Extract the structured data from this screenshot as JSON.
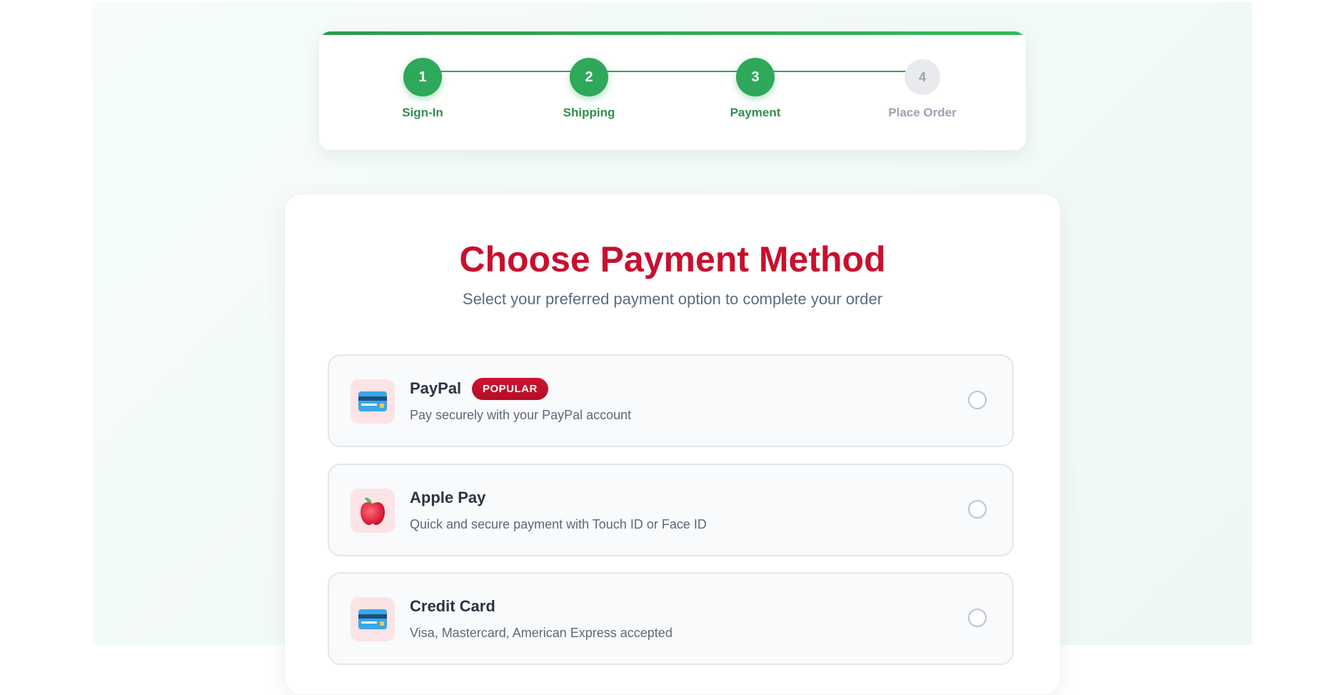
{
  "stepper": {
    "steps": [
      {
        "number": "1",
        "label": "Sign-In",
        "status": "done"
      },
      {
        "number": "2",
        "label": "Shipping",
        "status": "done"
      },
      {
        "number": "3",
        "label": "Payment",
        "status": "done"
      },
      {
        "number": "4",
        "label": "Place Order",
        "status": "pending"
      }
    ]
  },
  "main": {
    "title": "Choose Payment Method",
    "subtitle": "Select your preferred payment option to complete your order",
    "options": [
      {
        "name": "PayPal",
        "badge": "POPULAR",
        "description": "Pay securely with your PayPal account",
        "icon": "credit-card-icon",
        "selected": false
      },
      {
        "name": "Apple Pay",
        "description": "Quick and secure payment with Touch ID or Face ID",
        "icon": "apple-icon",
        "selected": false
      },
      {
        "name": "Credit Card",
        "description": "Visa, Mastercard, American Express accepted",
        "icon": "credit-card-icon",
        "selected": false
      }
    ]
  },
  "colors": {
    "accent": "#c8102e",
    "success": "#2ea85a",
    "pending": "#9aa3b2"
  }
}
